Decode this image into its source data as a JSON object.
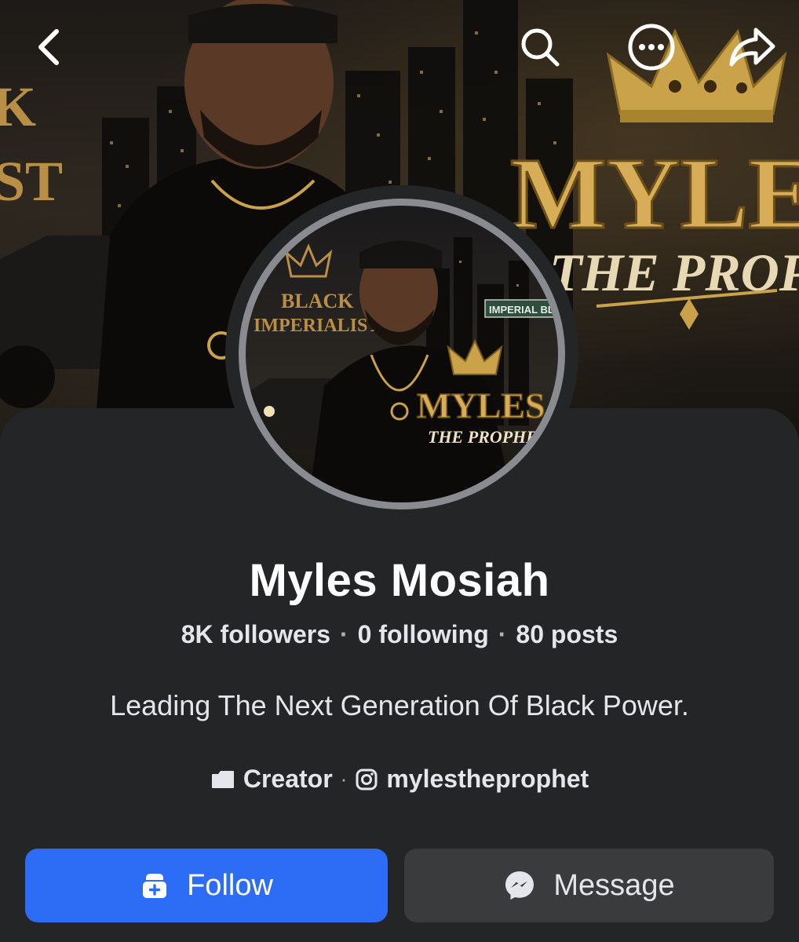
{
  "profile": {
    "name": "Myles Mosiah",
    "followers": "8K followers",
    "following": "0 following",
    "posts": "80 posts",
    "bio": "Leading The Next Generation Of Black Power.",
    "category": "Creator",
    "instagram_handle": "mylestheprophet"
  },
  "cover": {
    "title_text": "MYLE",
    "subtitle_text": "THE PROPHE",
    "left_text_1": "K",
    "left_text_2": "ST"
  },
  "avatar": {
    "shirt_text_1": "BLACK",
    "shirt_text_2": "IMPERIALIST",
    "street_sign": "IMPERIAL BL",
    "logo_title": "MYLES",
    "logo_subtitle": "THE PROPHET"
  },
  "separator": "·",
  "buttons": {
    "follow": "Follow",
    "message": "Message"
  },
  "icons": {
    "back": "chevron-left-icon",
    "search": "search-icon",
    "more": "more-icon",
    "share": "share-icon",
    "follow": "follow-icon",
    "messenger": "messenger-icon",
    "category": "category-icon",
    "instagram": "instagram-icon"
  },
  "colors": {
    "background": "#242526",
    "follow_button": "#2d6cf5",
    "message_button": "#3a3b3c",
    "gold": "#c9a24a"
  }
}
